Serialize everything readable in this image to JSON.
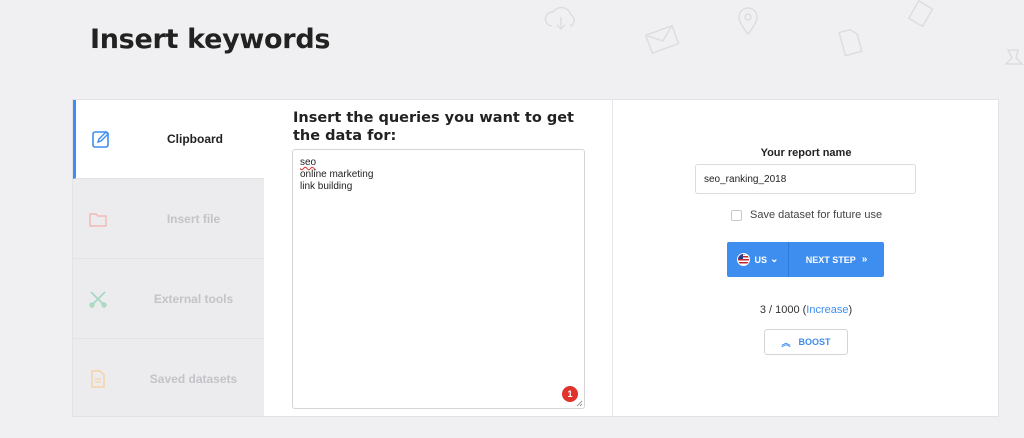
{
  "page": {
    "title": "Insert keywords"
  },
  "sidebar": {
    "items": [
      {
        "label": "Clipboard",
        "icon": "edit-icon",
        "active": true
      },
      {
        "label": "Insert file",
        "icon": "folder-icon",
        "active": false
      },
      {
        "label": "External tools",
        "icon": "tools-icon",
        "active": false
      },
      {
        "label": "Saved datasets",
        "icon": "document-icon",
        "active": false
      }
    ]
  },
  "queries": {
    "label": "Insert the queries you want to get the data for:",
    "lines": [
      "seo",
      "online marketing",
      "link building"
    ],
    "error_count": "1"
  },
  "report": {
    "name_label": "Your report name",
    "name_value": "seo_ranking_2018",
    "save_label": "Save dataset for future use",
    "country": "US",
    "next_label": "NEXT STEP",
    "quota_text": "3 / 1000 (",
    "increase_link": "Increase",
    "quota_close": ")",
    "boost_label": "BOOST"
  },
  "colors": {
    "accent": "#3e8ef0",
    "error": "#e0332b",
    "inactive_icon": "#f3b9b9"
  }
}
